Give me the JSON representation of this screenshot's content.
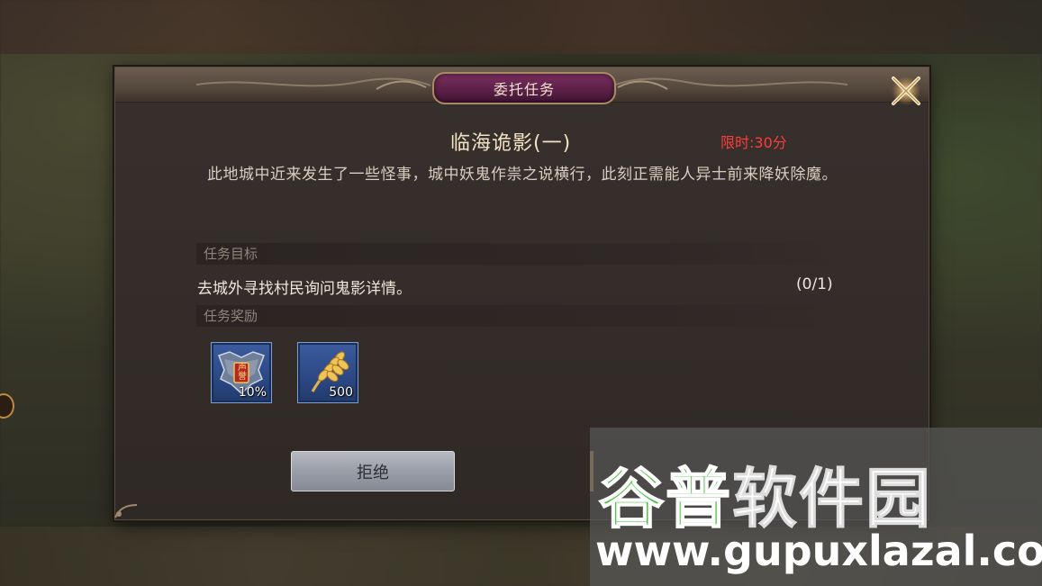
{
  "dialog": {
    "header_title": "委托任务",
    "quest_name": "临海诡影(一)",
    "time_limit": "限时:30分",
    "description": "此地城中近来发生了一些怪事，城中妖鬼作祟之说横行，此刻正需能人异士前来降妖除魔。",
    "objective_header": "任务目标",
    "objective_text": "去城外寻找村民询问鬼影详情。",
    "objective_progress": "(0/1)",
    "reward_header": "任务奖励",
    "rewards": [
      {
        "icon": "reputation-shield-icon",
        "badge": "声誉",
        "count": "10%"
      },
      {
        "icon": "wheat-icon",
        "count": "500"
      }
    ],
    "reject_label": "拒绝"
  },
  "watermark": {
    "title_green": "谷普",
    "title_white": "软件园",
    "url": "www.gupuxlazal.com"
  },
  "colors": {
    "time_limit": "#ff3c3c",
    "title_plaque": "#6a2a52",
    "reward_bg": "#2d4a86",
    "watermark_green": "#3fbf3a"
  }
}
